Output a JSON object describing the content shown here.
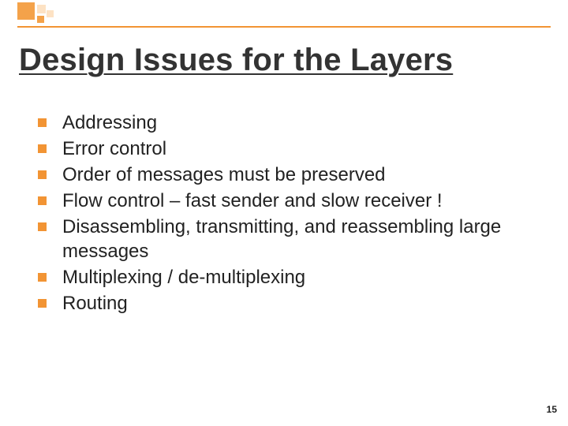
{
  "title": "Design Issues for the Layers",
  "bullets": [
    "Addressing",
    "Error control",
    "Order of messages must be preserved",
    "Flow control – fast sender and slow receiver !",
    "Disassembling, transmitting, and reassembling large messages",
    "Multiplexing / de-multiplexing",
    "Routing"
  ],
  "page_number": "15"
}
